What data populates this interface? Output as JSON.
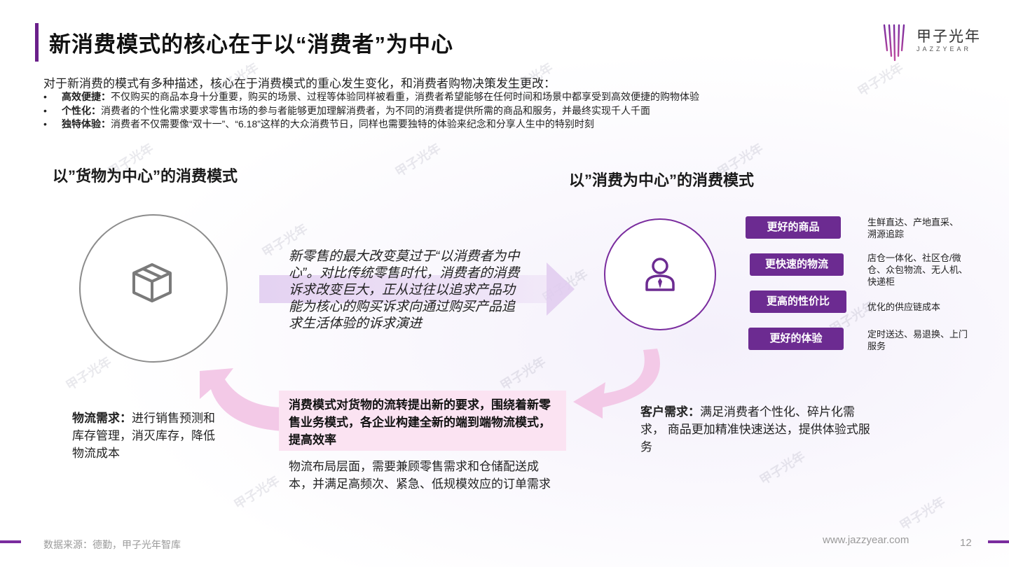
{
  "header": {
    "title": "新消费模式的核心在于以“消费者”为中心",
    "logo_name": "甲子光年",
    "logo_sub": "JAZZYEAR"
  },
  "intro": {
    "text": "对于新消费的模式有多种描述，核心在于消费模式的重心发生变化，和消费者购物决策发生更改：",
    "bullets": [
      {
        "bullet": "•",
        "label": "高效便捷：",
        "text": "不仅购买的商品本身十分重要，购买的场景、过程等体验同样被看重，消费者希望能够在任何时间和场景中都享受到高效便捷的购物体验"
      },
      {
        "bullet": "•",
        "label": "个性化：",
        "text": "消费者的个性化需求要求零售市场的参与者能够更加理解消费者，为不同的消费者提供所需的商品和服务，并最终实现千人千面"
      },
      {
        "bullet": "•",
        "label": "独特体验：",
        "text": "消费者不仅需要像“双十一”、“6.18”这样的大众消费节日，同样也需要独特的体验来纪念和分享人生中的特别时刻"
      }
    ]
  },
  "left": {
    "heading": "以”货物为中心”的消费模式",
    "icon": "box-icon",
    "label": "物流需求：",
    "text": "进行销售预测和库存管理，消灭库存，降低物流成本"
  },
  "middle": {
    "italic_text": "新零售的最大改变莫过于“以消费者为中心”。对比传统零售时代，消费者的消费诉求改变巨大，正从过往以追求产品功能为核心的购买诉求向通过购买产品追求生活体验的诉求演进",
    "highlight_text": "消费模式对货物的流转提出新的要求，围绕着新零售业务模式，各企业构建全新的端到端物流模式，提高效率",
    "lower_text": "物流布局层面，需要兼顾零售需求和仓储配送成本，并满足高频次、紧急、低规模效应的订单需求"
  },
  "right": {
    "heading": "以”消费为中心”的消费模式",
    "icon": "person-icon",
    "pills": [
      {
        "label": "更好的商品",
        "note": "生鲜直达、产地直采、溯源追踪"
      },
      {
        "label": "更快速的物流",
        "note": "店仓一体化、社区仓/微仓、众包物流、无人机、快递柜"
      },
      {
        "label": "更高的性价比",
        "note": "优化的供应链成本"
      },
      {
        "label": "更好的体验",
        "note": "定时送达、易退换、上门服务"
      }
    ],
    "label": "客户需求：",
    "text": "满足消费者个性化、碎片化需求， 商品更加精准快速送达，提供体验式服务"
  },
  "footer": {
    "source": "数据来源：德勤，甲子光年智库",
    "url": "www.jazzyear.com",
    "page": "12"
  },
  "colors": {
    "accent": "#6c2b91",
    "pink": "#fbe3f2",
    "arrow": "#f0c7e6"
  }
}
